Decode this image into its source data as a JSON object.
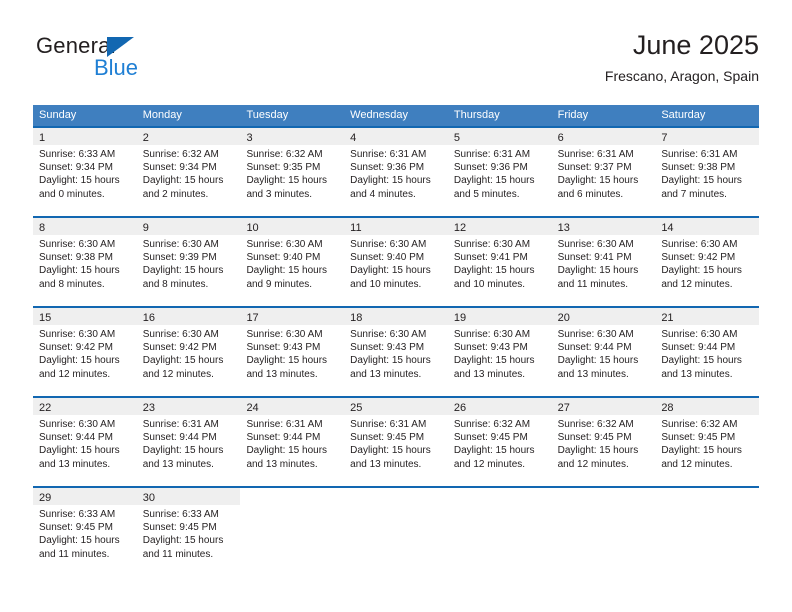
{
  "brand": {
    "name_part1": "General",
    "name_part2": "Blue",
    "logo_icon": "triangle-logo-icon",
    "accent_color": "#1267b1",
    "blue_text_color": "#1f7fd4"
  },
  "header": {
    "title": "June 2025",
    "subtitle": "Frescano, Aragon, Spain"
  },
  "theme": {
    "header_bg": "#3f7fbf",
    "separator": "#1267b1",
    "daynum_bg": "#efefef"
  },
  "weekdays": [
    "Sunday",
    "Monday",
    "Tuesday",
    "Wednesday",
    "Thursday",
    "Friday",
    "Saturday"
  ],
  "weeks": [
    [
      {
        "day": "1",
        "sunrise": "Sunrise: 6:33 AM",
        "sunset": "Sunset: 9:34 PM",
        "daylight_line1": "Daylight: 15 hours",
        "daylight_line2": "and 0 minutes."
      },
      {
        "day": "2",
        "sunrise": "Sunrise: 6:32 AM",
        "sunset": "Sunset: 9:34 PM",
        "daylight_line1": "Daylight: 15 hours",
        "daylight_line2": "and 2 minutes."
      },
      {
        "day": "3",
        "sunrise": "Sunrise: 6:32 AM",
        "sunset": "Sunset: 9:35 PM",
        "daylight_line1": "Daylight: 15 hours",
        "daylight_line2": "and 3 minutes."
      },
      {
        "day": "4",
        "sunrise": "Sunrise: 6:31 AM",
        "sunset": "Sunset: 9:36 PM",
        "daylight_line1": "Daylight: 15 hours",
        "daylight_line2": "and 4 minutes."
      },
      {
        "day": "5",
        "sunrise": "Sunrise: 6:31 AM",
        "sunset": "Sunset: 9:36 PM",
        "daylight_line1": "Daylight: 15 hours",
        "daylight_line2": "and 5 minutes."
      },
      {
        "day": "6",
        "sunrise": "Sunrise: 6:31 AM",
        "sunset": "Sunset: 9:37 PM",
        "daylight_line1": "Daylight: 15 hours",
        "daylight_line2": "and 6 minutes."
      },
      {
        "day": "7",
        "sunrise": "Sunrise: 6:31 AM",
        "sunset": "Sunset: 9:38 PM",
        "daylight_line1": "Daylight: 15 hours",
        "daylight_line2": "and 7 minutes."
      }
    ],
    [
      {
        "day": "8",
        "sunrise": "Sunrise: 6:30 AM",
        "sunset": "Sunset: 9:38 PM",
        "daylight_line1": "Daylight: 15 hours",
        "daylight_line2": "and 8 minutes."
      },
      {
        "day": "9",
        "sunrise": "Sunrise: 6:30 AM",
        "sunset": "Sunset: 9:39 PM",
        "daylight_line1": "Daylight: 15 hours",
        "daylight_line2": "and 8 minutes."
      },
      {
        "day": "10",
        "sunrise": "Sunrise: 6:30 AM",
        "sunset": "Sunset: 9:40 PM",
        "daylight_line1": "Daylight: 15 hours",
        "daylight_line2": "and 9 minutes."
      },
      {
        "day": "11",
        "sunrise": "Sunrise: 6:30 AM",
        "sunset": "Sunset: 9:40 PM",
        "daylight_line1": "Daylight: 15 hours",
        "daylight_line2": "and 10 minutes."
      },
      {
        "day": "12",
        "sunrise": "Sunrise: 6:30 AM",
        "sunset": "Sunset: 9:41 PM",
        "daylight_line1": "Daylight: 15 hours",
        "daylight_line2": "and 10 minutes."
      },
      {
        "day": "13",
        "sunrise": "Sunrise: 6:30 AM",
        "sunset": "Sunset: 9:41 PM",
        "daylight_line1": "Daylight: 15 hours",
        "daylight_line2": "and 11 minutes."
      },
      {
        "day": "14",
        "sunrise": "Sunrise: 6:30 AM",
        "sunset": "Sunset: 9:42 PM",
        "daylight_line1": "Daylight: 15 hours",
        "daylight_line2": "and 12 minutes."
      }
    ],
    [
      {
        "day": "15",
        "sunrise": "Sunrise: 6:30 AM",
        "sunset": "Sunset: 9:42 PM",
        "daylight_line1": "Daylight: 15 hours",
        "daylight_line2": "and 12 minutes."
      },
      {
        "day": "16",
        "sunrise": "Sunrise: 6:30 AM",
        "sunset": "Sunset: 9:42 PM",
        "daylight_line1": "Daylight: 15 hours",
        "daylight_line2": "and 12 minutes."
      },
      {
        "day": "17",
        "sunrise": "Sunrise: 6:30 AM",
        "sunset": "Sunset: 9:43 PM",
        "daylight_line1": "Daylight: 15 hours",
        "daylight_line2": "and 13 minutes."
      },
      {
        "day": "18",
        "sunrise": "Sunrise: 6:30 AM",
        "sunset": "Sunset: 9:43 PM",
        "daylight_line1": "Daylight: 15 hours",
        "daylight_line2": "and 13 minutes."
      },
      {
        "day": "19",
        "sunrise": "Sunrise: 6:30 AM",
        "sunset": "Sunset: 9:43 PM",
        "daylight_line1": "Daylight: 15 hours",
        "daylight_line2": "and 13 minutes."
      },
      {
        "day": "20",
        "sunrise": "Sunrise: 6:30 AM",
        "sunset": "Sunset: 9:44 PM",
        "daylight_line1": "Daylight: 15 hours",
        "daylight_line2": "and 13 minutes."
      },
      {
        "day": "21",
        "sunrise": "Sunrise: 6:30 AM",
        "sunset": "Sunset: 9:44 PM",
        "daylight_line1": "Daylight: 15 hours",
        "daylight_line2": "and 13 minutes."
      }
    ],
    [
      {
        "day": "22",
        "sunrise": "Sunrise: 6:30 AM",
        "sunset": "Sunset: 9:44 PM",
        "daylight_line1": "Daylight: 15 hours",
        "daylight_line2": "and 13 minutes."
      },
      {
        "day": "23",
        "sunrise": "Sunrise: 6:31 AM",
        "sunset": "Sunset: 9:44 PM",
        "daylight_line1": "Daylight: 15 hours",
        "daylight_line2": "and 13 minutes."
      },
      {
        "day": "24",
        "sunrise": "Sunrise: 6:31 AM",
        "sunset": "Sunset: 9:44 PM",
        "daylight_line1": "Daylight: 15 hours",
        "daylight_line2": "and 13 minutes."
      },
      {
        "day": "25",
        "sunrise": "Sunrise: 6:31 AM",
        "sunset": "Sunset: 9:45 PM",
        "daylight_line1": "Daylight: 15 hours",
        "daylight_line2": "and 13 minutes."
      },
      {
        "day": "26",
        "sunrise": "Sunrise: 6:32 AM",
        "sunset": "Sunset: 9:45 PM",
        "daylight_line1": "Daylight: 15 hours",
        "daylight_line2": "and 12 minutes."
      },
      {
        "day": "27",
        "sunrise": "Sunrise: 6:32 AM",
        "sunset": "Sunset: 9:45 PM",
        "daylight_line1": "Daylight: 15 hours",
        "daylight_line2": "and 12 minutes."
      },
      {
        "day": "28",
        "sunrise": "Sunrise: 6:32 AM",
        "sunset": "Sunset: 9:45 PM",
        "daylight_line1": "Daylight: 15 hours",
        "daylight_line2": "and 12 minutes."
      }
    ],
    [
      {
        "day": "29",
        "sunrise": "Sunrise: 6:33 AM",
        "sunset": "Sunset: 9:45 PM",
        "daylight_line1": "Daylight: 15 hours",
        "daylight_line2": "and 11 minutes."
      },
      {
        "day": "30",
        "sunrise": "Sunrise: 6:33 AM",
        "sunset": "Sunset: 9:45 PM",
        "daylight_line1": "Daylight: 15 hours",
        "daylight_line2": "and 11 minutes."
      },
      {
        "day": "",
        "sunrise": "",
        "sunset": "",
        "daylight_line1": "",
        "daylight_line2": ""
      },
      {
        "day": "",
        "sunrise": "",
        "sunset": "",
        "daylight_line1": "",
        "daylight_line2": ""
      },
      {
        "day": "",
        "sunrise": "",
        "sunset": "",
        "daylight_line1": "",
        "daylight_line2": ""
      },
      {
        "day": "",
        "sunrise": "",
        "sunset": "",
        "daylight_line1": "",
        "daylight_line2": ""
      },
      {
        "day": "",
        "sunrise": "",
        "sunset": "",
        "daylight_line1": "",
        "daylight_line2": ""
      }
    ]
  ]
}
